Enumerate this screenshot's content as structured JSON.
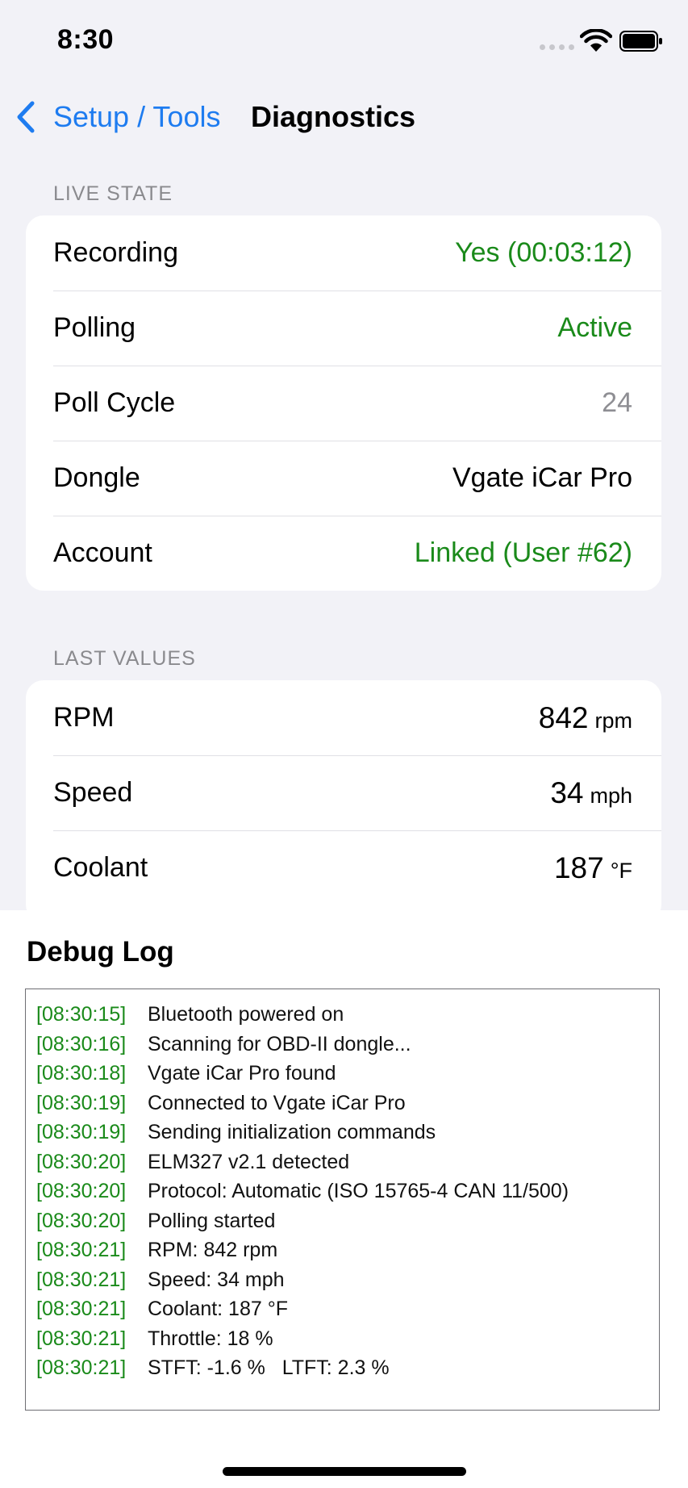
{
  "status_bar": {
    "time": "8:30"
  },
  "nav": {
    "back_label": "Setup / Tools",
    "title": "Diagnostics"
  },
  "live_state": {
    "header": "LIVE STATE",
    "rows": [
      {
        "label": "Recording",
        "value": "Yes (00:03:12)"
      },
      {
        "label": "Polling",
        "value": "Active"
      },
      {
        "label": "Poll Cycle",
        "value": "24"
      },
      {
        "label": "Dongle",
        "value": "Vgate iCar Pro"
      },
      {
        "label": "Account",
        "value": "Linked (User #62)"
      }
    ]
  },
  "last_values": {
    "header": "LAST VALUES",
    "rows": [
      {
        "label": "RPM",
        "value": "842",
        "unit": "rpm"
      },
      {
        "label": "Speed",
        "value": "34",
        "unit": "mph"
      },
      {
        "label": "Coolant",
        "value": "187",
        "unit": "°F"
      }
    ]
  },
  "debug_log": {
    "title": "Debug Log",
    "lines": [
      {
        "ts": "[08:30:15]",
        "msg": "Bluetooth powered on"
      },
      {
        "ts": "[08:30:16]",
        "msg": "Scanning for OBD-II dongle..."
      },
      {
        "ts": "[08:30:18]",
        "msg": "Vgate iCar Pro found"
      },
      {
        "ts": "[08:30:19]",
        "msg": "Connected to Vgate iCar Pro"
      },
      {
        "ts": "[08:30:19]",
        "msg": "Sending initialization commands"
      },
      {
        "ts": "[08:30:20]",
        "msg": "ELM327 v2.1 detected"
      },
      {
        "ts": "[08:30:20]",
        "msg": "Protocol: Automatic (ISO 15765-4 CAN 11/500)"
      },
      {
        "ts": "[08:30:20]",
        "msg": "Polling started"
      },
      {
        "ts": "[08:30:21]",
        "msg": "RPM: 842 rpm"
      },
      {
        "ts": "[08:30:21]",
        "msg": "Speed: 34 mph"
      },
      {
        "ts": "[08:30:21]",
        "msg": "Coolant: 187 °F"
      },
      {
        "ts": "[08:30:21]",
        "msg": "Throttle: 18 %"
      },
      {
        "ts": "[08:30:21]",
        "msg": "STFT: -1.6 %   LTFT: 2.3 %"
      }
    ]
  },
  "colors": {
    "accent": "#1E7CF0",
    "positive": "#1A8A1A",
    "secondary_text": "#8E8E93"
  },
  "icons": {
    "back": "chevron-left-icon",
    "wifi": "wifi-icon",
    "battery": "battery-icon",
    "signal": "signal-dots-icon"
  }
}
